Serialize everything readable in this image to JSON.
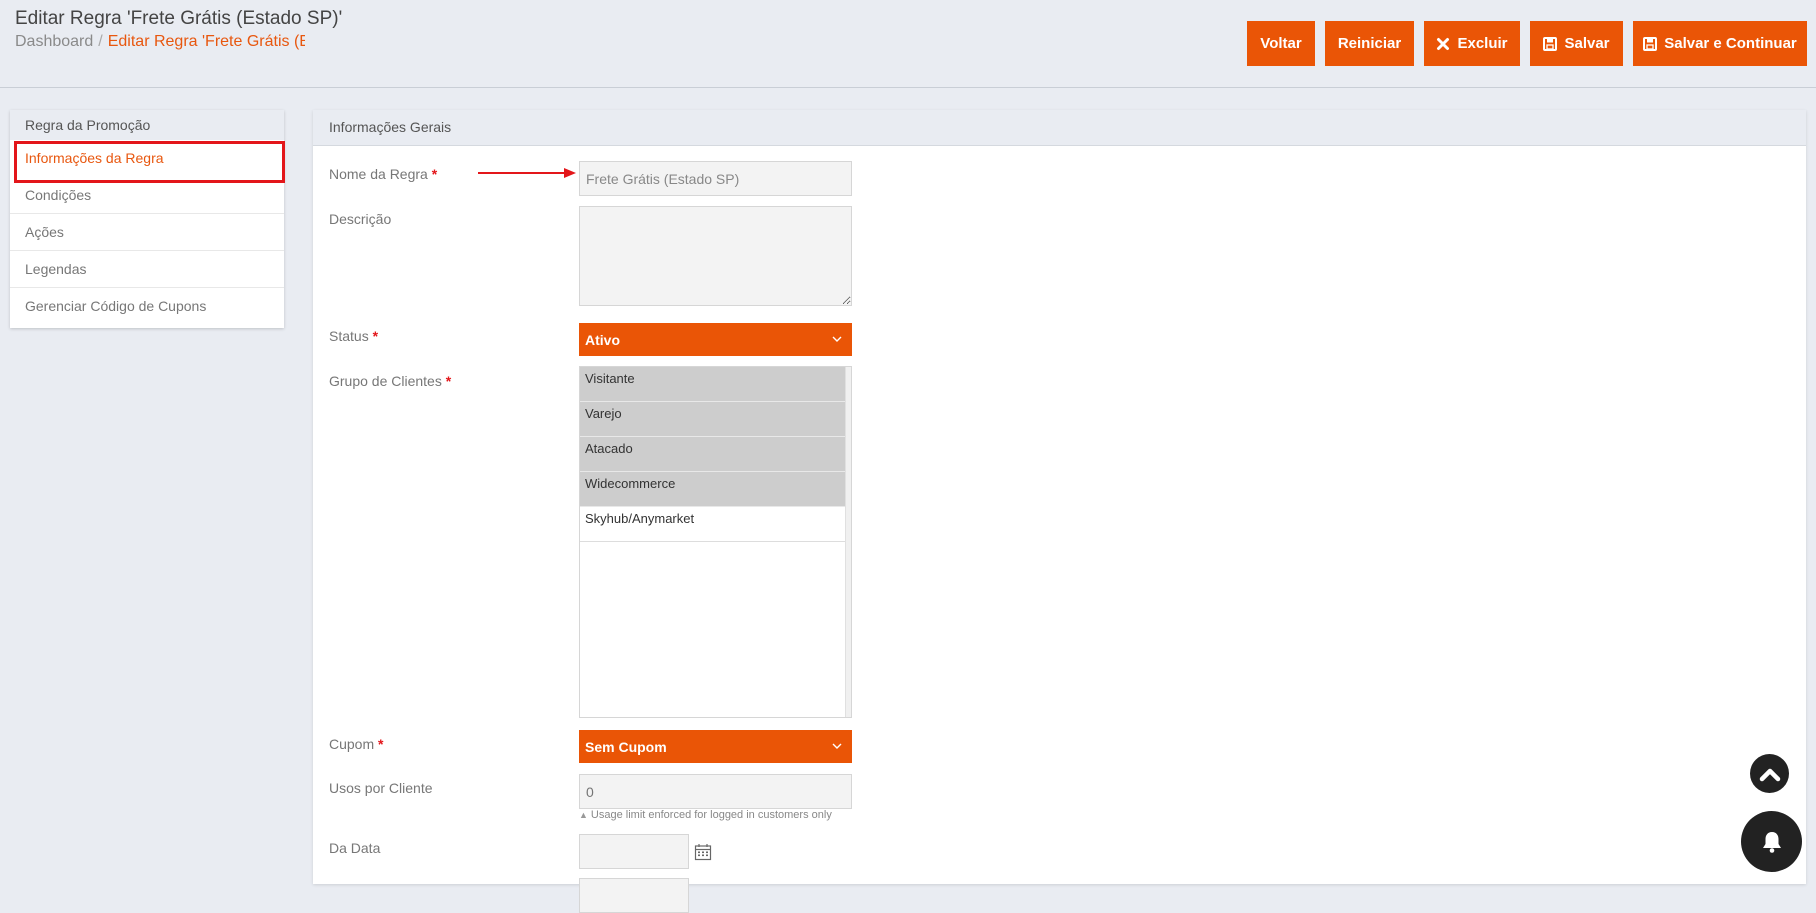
{
  "header": {
    "title": "Editar Regra 'Frete Grátis (Estado SP)'",
    "breadcrumb": {
      "home": "Dashboard",
      "separator": "/",
      "current": "Editar Regra 'Frete Grátis (Es"
    }
  },
  "toolbar": {
    "back_label": "Voltar",
    "reset_label": "Reiniciar",
    "delete_label": "Excluir",
    "save_label": "Salvar",
    "save_continue_label": "Salvar e Continuar"
  },
  "sidebar": {
    "title": "Regra da Promoção",
    "items": [
      {
        "label": "Informações da Regra",
        "active": true
      },
      {
        "label": "Condições"
      },
      {
        "label": "Ações"
      },
      {
        "label": "Legendas"
      },
      {
        "label": "Gerenciar Código de Cupons"
      }
    ]
  },
  "form": {
    "section_title": "Informações Gerais",
    "required_mark": "*",
    "name_label": "Nome da Regra",
    "name_value": "Frete Grátis (Estado SP)",
    "description_label": "Descrição",
    "status_label": "Status",
    "status_value": "Ativo",
    "groups_label": "Grupo de Clientes",
    "groups": [
      {
        "label": "Visitante",
        "selected": true
      },
      {
        "label": "Varejo",
        "selected": true
      },
      {
        "label": "Atacado",
        "selected": true
      },
      {
        "label": "Widecommerce",
        "selected": true
      },
      {
        "label": "Skyhub/Anymarket",
        "selected": false
      }
    ],
    "coupon_label": "Cupom",
    "coupon_value": "Sem Cupom",
    "uses_label": "Usos por Cliente",
    "uses_placeholder": "0",
    "uses_note": "Usage limit enforced for logged in customers only",
    "from_date_label": "Da Data"
  },
  "colors": {
    "accent": "#ea5506",
    "highlight": "#e3161a",
    "background": "#e9ecf2"
  },
  "icons": [
    "close-icon",
    "save-icon",
    "chevron-down-icon",
    "calendar-icon",
    "chevron-up-icon",
    "bell-icon",
    "arrow-right-icon"
  ]
}
